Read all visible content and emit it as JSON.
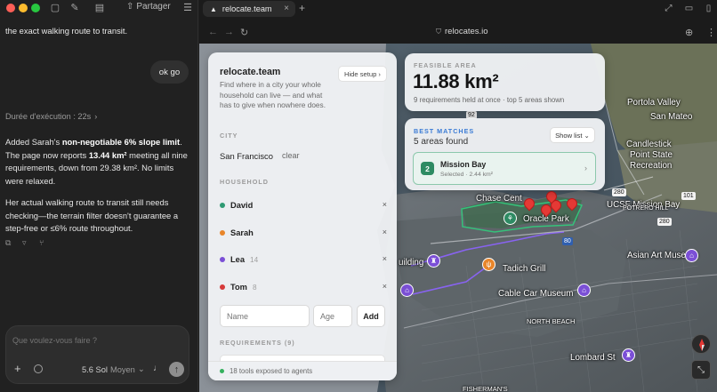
{
  "chat": {
    "share_label": "Partager",
    "fragment": "the exact walking route to transit.",
    "user_message": "ok go",
    "duration": "Durée d'exécution : 22s",
    "reply_1_a": "Added Sarah's ",
    "reply_1_b": "non-negotiable 6% slope limit",
    "reply_1_c": ". The page now reports ",
    "reply_1_d": "13.44 km²",
    "reply_1_e": " meeting all nine requirements, down from 29.38 km². No limits were relaxed.",
    "reply_2": "Her actual walking route to transit still needs checking—the terrain filter doesn't guarantee a step-free or ≤6% route throughout.",
    "composer_placeholder": "Que voulez-vous faire ?",
    "model_name": "5.6 Sol",
    "model_mode": "Moyen"
  },
  "browser": {
    "tab_title": "relocate.team",
    "url": "relocates.io"
  },
  "setup": {
    "title": "relocate.team",
    "hide_label": "Hide setup ›",
    "description": "Find where in a city your whole household can live — and what has to give when nowhere does.",
    "city_heading": "CITY",
    "city_value": "San Francisco",
    "clear_label": "clear",
    "household_heading": "HOUSEHOLD",
    "members": [
      {
        "name": "David",
        "age": "",
        "color": "#2e9a73"
      },
      {
        "name": "Sarah",
        "age": "",
        "color": "#e8852a"
      },
      {
        "name": "Lea",
        "age": "14",
        "color": "#7b4fd6"
      },
      {
        "name": "Tom",
        "age": "8",
        "color": "#d63a3a"
      }
    ],
    "remove_symbol": "×",
    "name_placeholder": "Name",
    "age_placeholder": "Age",
    "add_label": "Add",
    "requirements_heading": "REQUIREMENTS (9)",
    "tools_footer": "18 tools exposed to agents"
  },
  "feasible": {
    "label": "FEASIBLE AREA",
    "value": "11.88 km²",
    "sub": "9 requirements held at once · top 5 areas shown"
  },
  "matches": {
    "label": "BEST MATCHES",
    "count_text": "5 areas found",
    "show_list": "Show list ⌄",
    "top": {
      "rank": "2",
      "name": "Mission Bay",
      "meta": "Selected · 2.44 km²"
    }
  },
  "map": {
    "labels": {
      "portola": "Portola Valley",
      "san_mateo": "San Mateo",
      "candlestick": "Candlestick",
      "point_state": "Point State",
      "recreation": "Recreation",
      "ucsf": "UCSF Mission Bay",
      "potrero": "POTRERO HILL",
      "chase": "Chase Cent",
      "oracle": "Oracle Park",
      "tadich": "Tadich Grill",
      "asian_art": "Asian Art Museum",
      "building": "uilding",
      "cable_car": "Cable Car Museum",
      "north_beach": "NORTH BEACH",
      "lombard": "Lombard St",
      "fishermans": "FISHERMAN'S"
    },
    "shields": {
      "a": "92",
      "b": "280",
      "c": "101",
      "d": "80",
      "e": "280"
    }
  }
}
